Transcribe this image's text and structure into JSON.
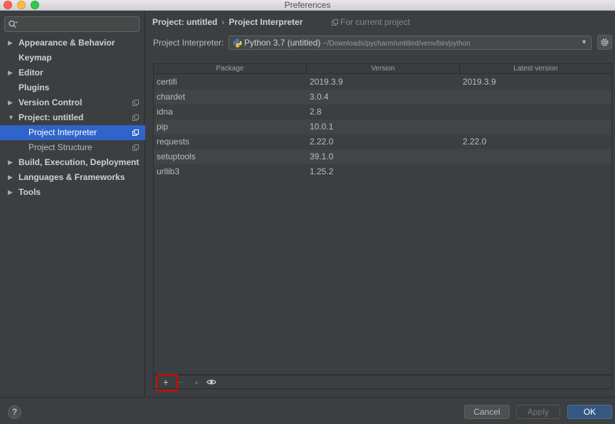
{
  "window": {
    "title": "Preferences"
  },
  "sidebar": {
    "search": {
      "value": "",
      "placeholder": ""
    },
    "items": [
      {
        "label": "Appearance & Behavior",
        "arrow": "▶",
        "bold": true,
        "copy": false
      },
      {
        "label": "Keymap",
        "arrow": "",
        "bold": true,
        "copy": false
      },
      {
        "label": "Editor",
        "arrow": "▶",
        "bold": true,
        "copy": false
      },
      {
        "label": "Plugins",
        "arrow": "",
        "bold": true,
        "copy": false
      },
      {
        "label": "Version Control",
        "arrow": "▶",
        "bold": true,
        "copy": true
      },
      {
        "label": "Project: untitled",
        "arrow": "▼",
        "bold": true,
        "copy": true
      },
      {
        "label": "Project Interpreter",
        "arrow": "",
        "bold": false,
        "child": true,
        "selected": true,
        "copy": true
      },
      {
        "label": "Project Structure",
        "arrow": "",
        "bold": false,
        "child": true,
        "copy": true
      },
      {
        "label": "Build, Execution, Deployment",
        "arrow": "▶",
        "bold": true,
        "copy": false
      },
      {
        "label": "Languages & Frameworks",
        "arrow": "▶",
        "bold": true,
        "copy": false
      },
      {
        "label": "Tools",
        "arrow": "▶",
        "bold": true,
        "copy": false
      }
    ]
  },
  "main": {
    "breadcrumb": {
      "project": "Project: untitled",
      "separator": "›",
      "page": "Project Interpreter"
    },
    "for_current_project": "For current project",
    "interpreter": {
      "label": "Project Interpreter:",
      "name": "Python 3.7 (untitled)",
      "path": "~/Downloads/pycharm/untitled/venv/bin/python"
    },
    "table": {
      "headers": [
        "Package",
        "Version",
        "Latest version"
      ],
      "rows": [
        [
          "certifi",
          "2019.3.9",
          "2019.3.9"
        ],
        [
          "chardet",
          "3.0.4",
          ""
        ],
        [
          "idna",
          "2.8",
          ""
        ],
        [
          "pip",
          "10.0.1",
          ""
        ],
        [
          "requests",
          "2.22.0",
          "2.22.0"
        ],
        [
          "setuptools",
          "39.1.0",
          ""
        ],
        [
          "urllib3",
          "1.25.2",
          ""
        ]
      ]
    },
    "toolbar": {
      "add": "+",
      "remove": "−",
      "upgrade": "▲"
    }
  },
  "footer": {
    "help": "?",
    "cancel": "Cancel",
    "apply": "Apply",
    "ok": "OK"
  },
  "colors": {
    "background": "#3c3f41",
    "selection": "#2f65ca",
    "primary_button": "#365880",
    "highlight": "#e00000"
  }
}
